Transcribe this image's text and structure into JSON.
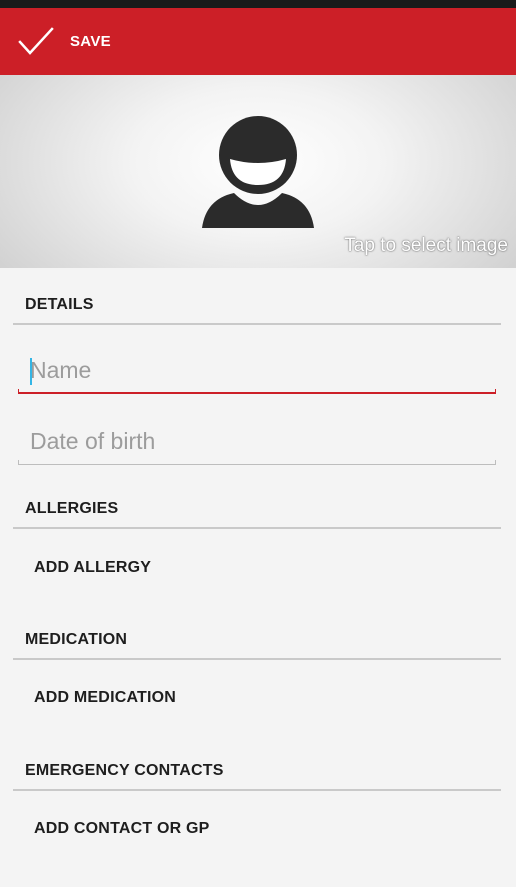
{
  "toolbar": {
    "save_label": "SAVE",
    "save_icon": "check-icon",
    "background_color": "#cc1f27"
  },
  "photo": {
    "avatar_icon": "person-avatar-icon",
    "hint": "Tap to select image"
  },
  "details": {
    "header": "DETAILS",
    "name_placeholder": "Name",
    "name_value": "",
    "dob_placeholder": "Date of birth",
    "dob_value": ""
  },
  "allergies": {
    "header": "ALLERGIES",
    "add_label": "ADD ALLERGY"
  },
  "medication": {
    "header": "MEDICATION",
    "add_label": "ADD MEDICATION"
  },
  "emergency_contacts": {
    "header": "EMERGENCY CONTACTS",
    "add_label": "ADD CONTACT OR GP"
  },
  "colors": {
    "accent": "#cc1f27",
    "cursor": "#33b5e5"
  }
}
